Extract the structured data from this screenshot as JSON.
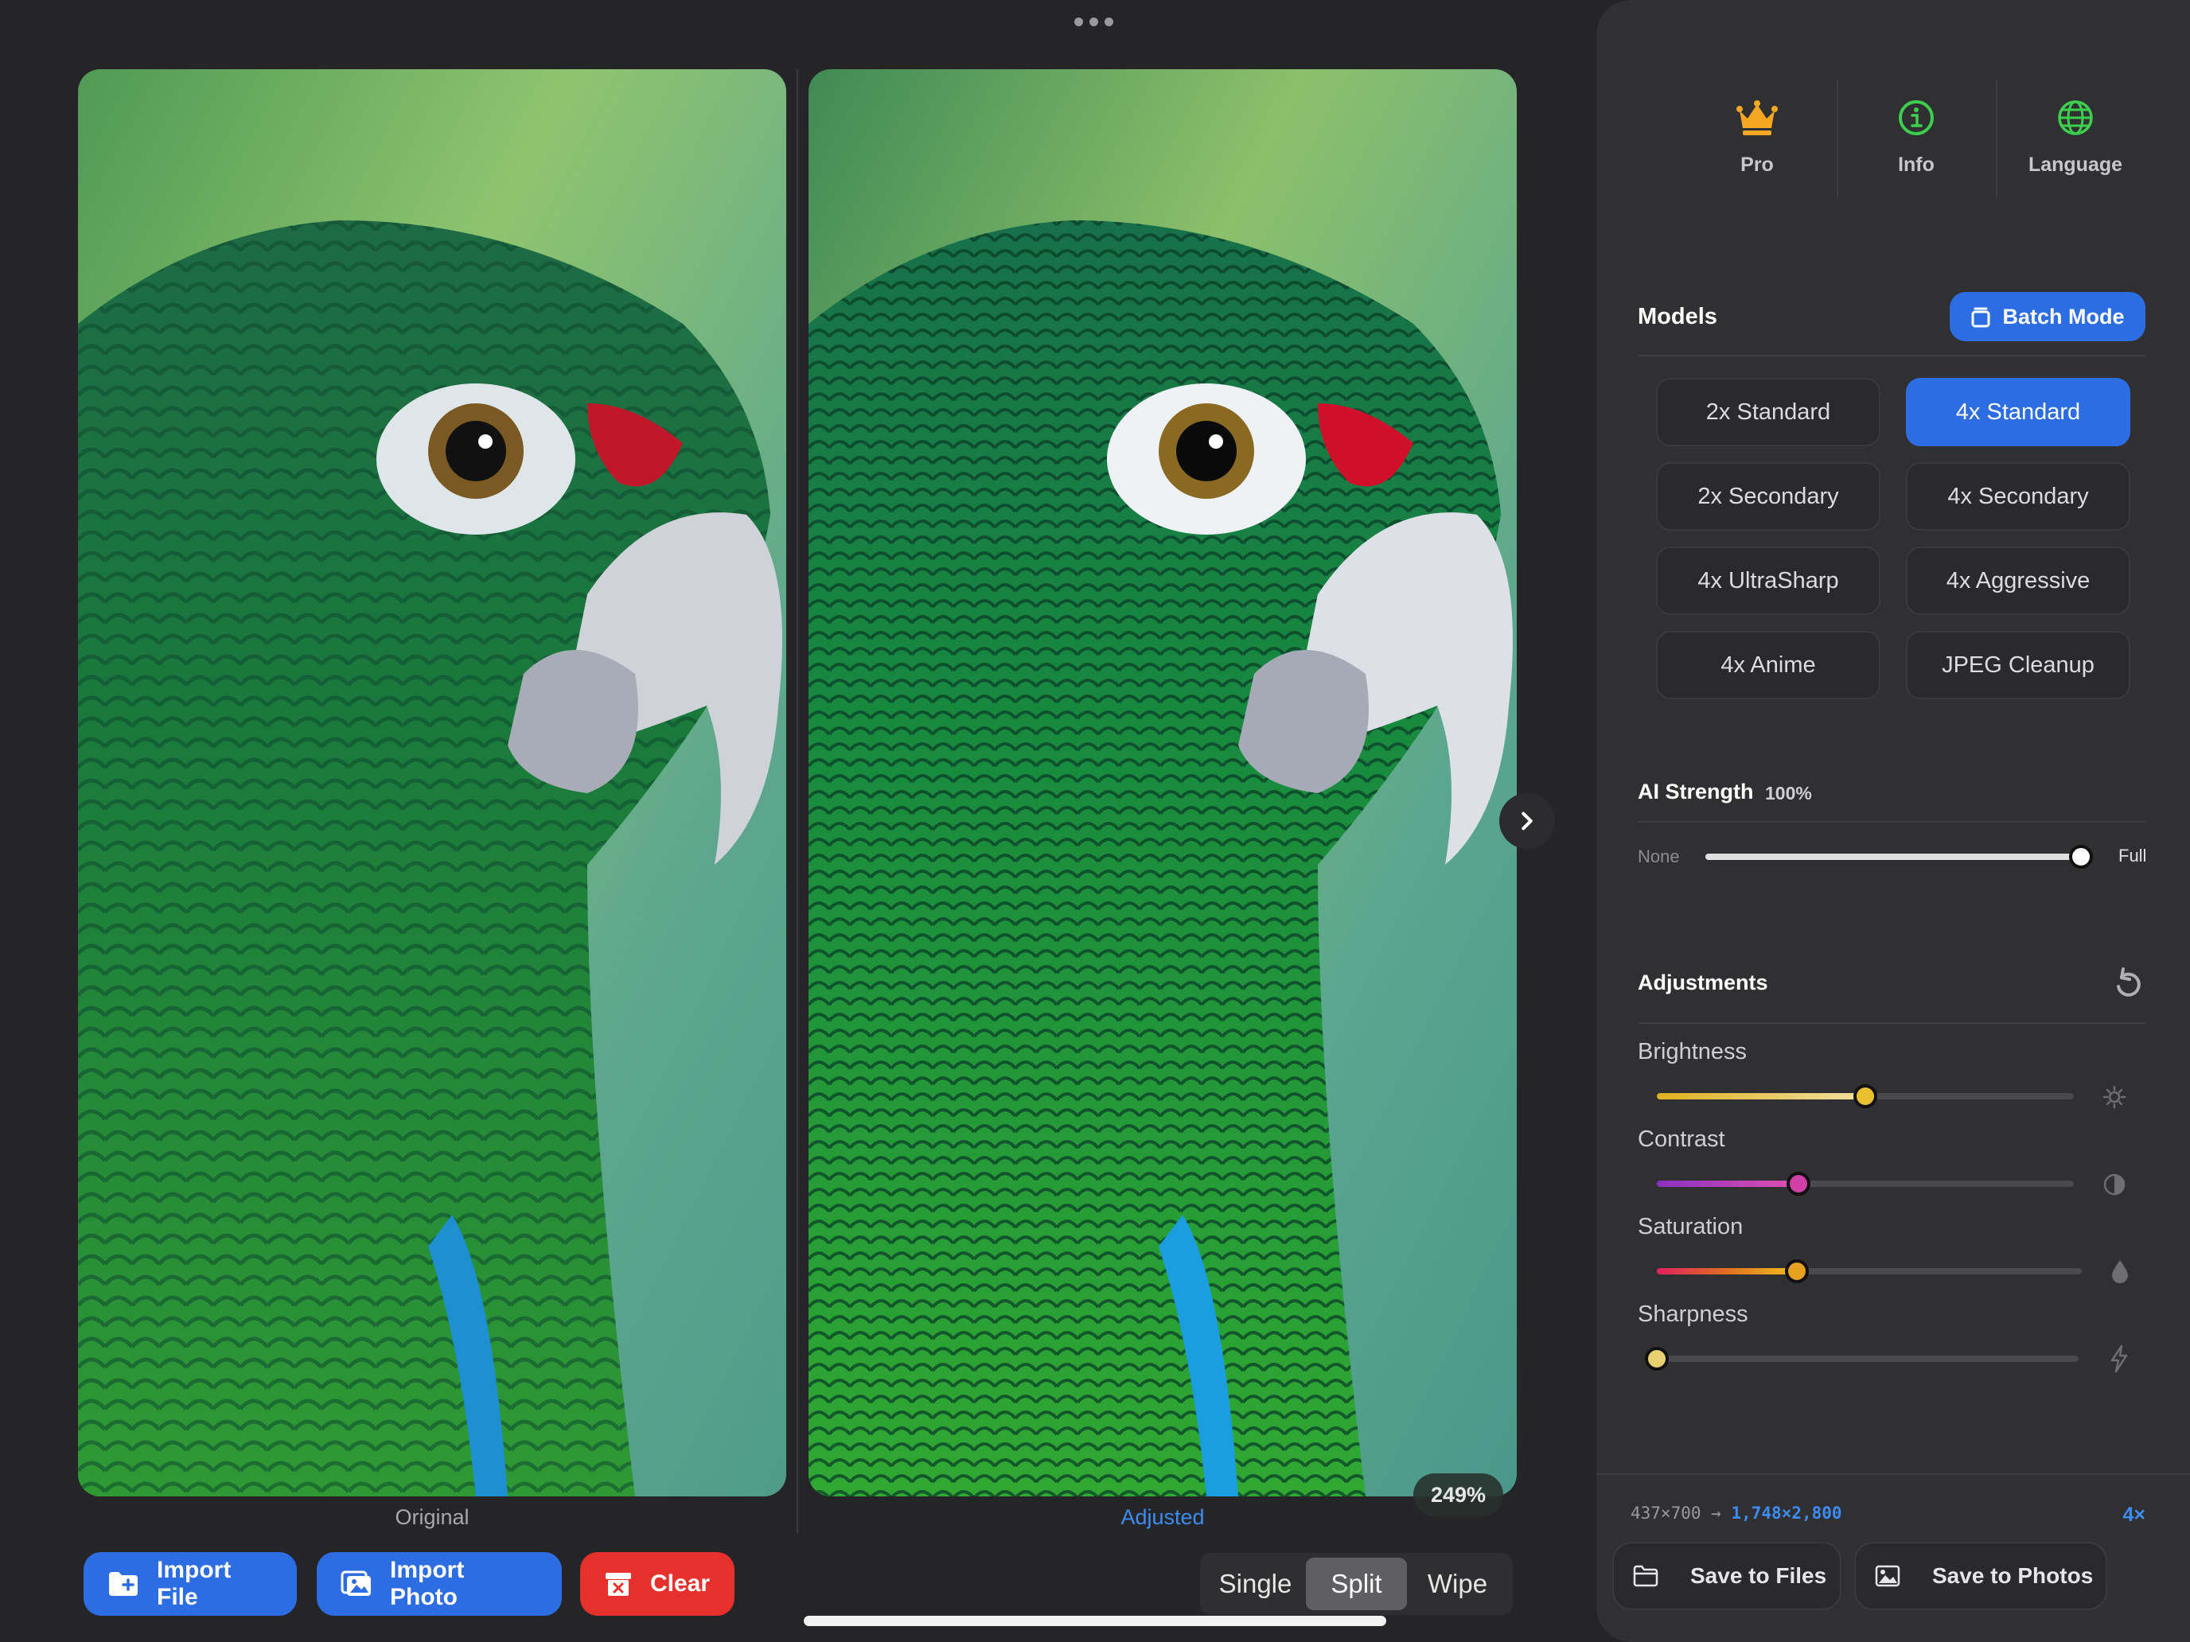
{
  "viewer": {
    "original_caption": "Original",
    "adjusted_caption": "Adjusted",
    "zoom": "249%"
  },
  "toolbar": {
    "import_file": "Import File",
    "import_photo": "Import Photo",
    "clear": "Clear"
  },
  "view_modes": {
    "items": [
      "Single",
      "Split",
      "Wipe"
    ],
    "selected": "Split"
  },
  "sidebar": {
    "top_icons": [
      {
        "label": "Pro",
        "icon": "crown-icon",
        "color": "#f5a623"
      },
      {
        "label": "Info",
        "icon": "info-icon",
        "color": "#3ccf4e"
      },
      {
        "label": "Language",
        "icon": "globe-icon",
        "color": "#3ccf4e"
      }
    ],
    "models_title": "Models",
    "batch_mode": "Batch Mode",
    "models": [
      "2x Standard",
      "4x Standard",
      "2x Secondary",
      "4x Secondary",
      "4x UltraSharp",
      "4x Aggressive",
      "4x Anime",
      "JPEG Cleanup"
    ],
    "selected_model": "4x Standard",
    "ai_strength": {
      "label": "AI Strength",
      "value_text": "100%",
      "value": 1.0,
      "min_label": "None",
      "max_label": "Full"
    },
    "adjustments_title": "Adjustments",
    "adjustments": [
      {
        "label": "Brightness",
        "value": 0.5,
        "icon": "sun-icon"
      },
      {
        "label": "Contrast",
        "value": 0.34,
        "icon": "contrast-icon"
      },
      {
        "label": "Saturation",
        "value": 0.33,
        "icon": "drop-icon"
      },
      {
        "label": "Sharpness",
        "value": 0.0,
        "icon": "bolt-icon"
      }
    ],
    "dimensions": {
      "from": "437×700",
      "arrow": "→",
      "to": "1,748×2,800",
      "scale": "4×"
    },
    "save_files": "Save to Files",
    "save_photos": "Save to Photos"
  },
  "colors": {
    "accent": "#2c6de3",
    "danger": "#e5302b",
    "background": "#252527",
    "sidebar": "#303033"
  }
}
